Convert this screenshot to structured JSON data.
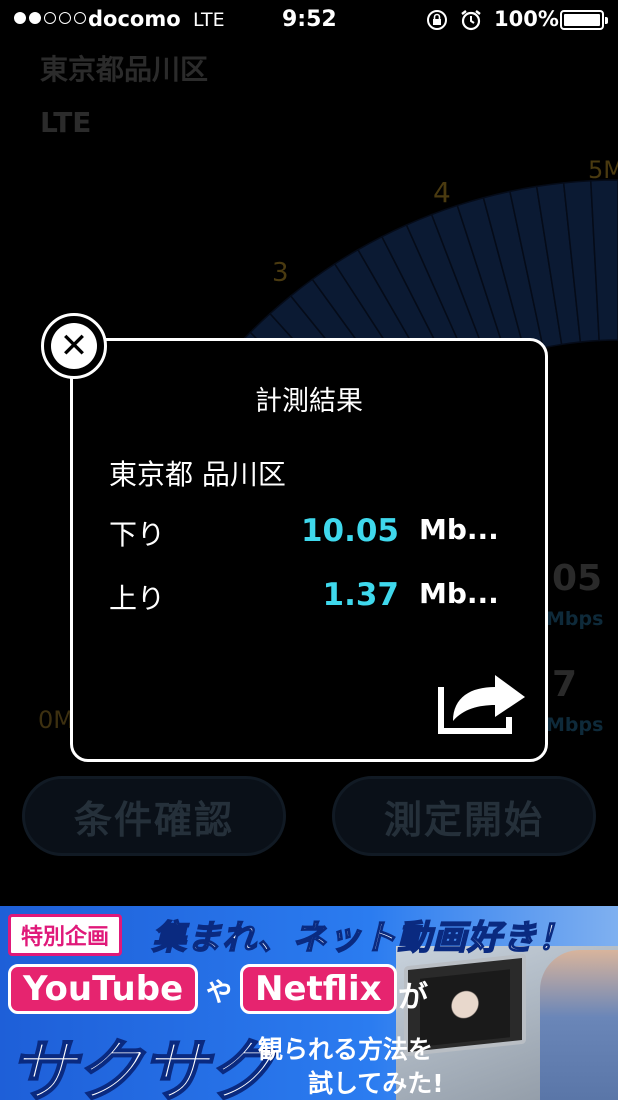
{
  "status_bar": {
    "carrier": "docomo",
    "network": "LTE",
    "time": "9:52",
    "battery": "100%",
    "signal_bars_filled": 2,
    "signal_bars_total": 5,
    "battery_level": 1.0
  },
  "background": {
    "location": "東京都品川区",
    "network": "LTE",
    "gauge_labels": [
      "0M",
      "3",
      "4",
      "5M"
    ],
    "download_value_partial": "05",
    "download_unit": "Mbps",
    "upload_value_partial": "7",
    "upload_unit": "Mbps",
    "buttons": {
      "conditions": "条件確認",
      "start": "測定開始"
    }
  },
  "result_dialog": {
    "title": "計測結果",
    "location": "東京都 品川区",
    "rows": [
      {
        "label": "下り",
        "value": "10.05",
        "unit": "Mb..."
      },
      {
        "label": "上り",
        "value": "1.37",
        "unit": "Mb..."
      }
    ],
    "close_icon": "close-icon",
    "share_icon": "share-icon"
  },
  "ad": {
    "tag": "特別企画",
    "headline": "集まれ、ネット動画好き！",
    "pill_youtube": "YouTube",
    "connector_ya": "や",
    "pill_netflix": "Netflix",
    "connector_ga": "が",
    "big_text": "サクサク",
    "sub_line1": "観られる方法を",
    "sub_line2": "試してみた!",
    "colors": {
      "accent_pink": "#e6246f",
      "accent_blue": "#1e5fd8",
      "result_cyan": "#3fd8ec"
    }
  }
}
